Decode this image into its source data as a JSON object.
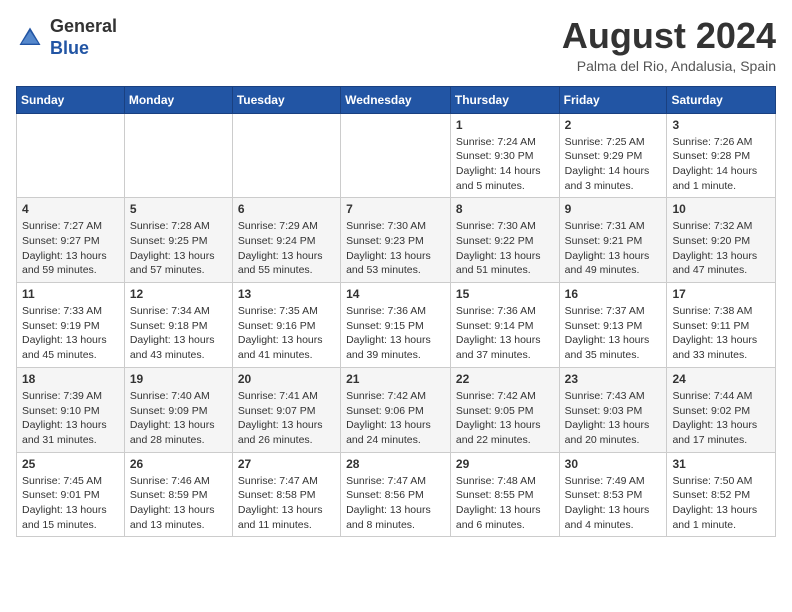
{
  "header": {
    "logo": {
      "general": "General",
      "blue": "Blue"
    },
    "month_year": "August 2024",
    "location": "Palma del Rio, Andalusia, Spain"
  },
  "days_of_week": [
    "Sunday",
    "Monday",
    "Tuesday",
    "Wednesday",
    "Thursday",
    "Friday",
    "Saturday"
  ],
  "weeks": [
    [
      {
        "day": "",
        "info": ""
      },
      {
        "day": "",
        "info": ""
      },
      {
        "day": "",
        "info": ""
      },
      {
        "day": "",
        "info": ""
      },
      {
        "day": "1",
        "info": "Sunrise: 7:24 AM\nSunset: 9:30 PM\nDaylight: 14 hours\nand 5 minutes."
      },
      {
        "day": "2",
        "info": "Sunrise: 7:25 AM\nSunset: 9:29 PM\nDaylight: 14 hours\nand 3 minutes."
      },
      {
        "day": "3",
        "info": "Sunrise: 7:26 AM\nSunset: 9:28 PM\nDaylight: 14 hours\nand 1 minute."
      }
    ],
    [
      {
        "day": "4",
        "info": "Sunrise: 7:27 AM\nSunset: 9:27 PM\nDaylight: 13 hours\nand 59 minutes."
      },
      {
        "day": "5",
        "info": "Sunrise: 7:28 AM\nSunset: 9:25 PM\nDaylight: 13 hours\nand 57 minutes."
      },
      {
        "day": "6",
        "info": "Sunrise: 7:29 AM\nSunset: 9:24 PM\nDaylight: 13 hours\nand 55 minutes."
      },
      {
        "day": "7",
        "info": "Sunrise: 7:30 AM\nSunset: 9:23 PM\nDaylight: 13 hours\nand 53 minutes."
      },
      {
        "day": "8",
        "info": "Sunrise: 7:30 AM\nSunset: 9:22 PM\nDaylight: 13 hours\nand 51 minutes."
      },
      {
        "day": "9",
        "info": "Sunrise: 7:31 AM\nSunset: 9:21 PM\nDaylight: 13 hours\nand 49 minutes."
      },
      {
        "day": "10",
        "info": "Sunrise: 7:32 AM\nSunset: 9:20 PM\nDaylight: 13 hours\nand 47 minutes."
      }
    ],
    [
      {
        "day": "11",
        "info": "Sunrise: 7:33 AM\nSunset: 9:19 PM\nDaylight: 13 hours\nand 45 minutes."
      },
      {
        "day": "12",
        "info": "Sunrise: 7:34 AM\nSunset: 9:18 PM\nDaylight: 13 hours\nand 43 minutes."
      },
      {
        "day": "13",
        "info": "Sunrise: 7:35 AM\nSunset: 9:16 PM\nDaylight: 13 hours\nand 41 minutes."
      },
      {
        "day": "14",
        "info": "Sunrise: 7:36 AM\nSunset: 9:15 PM\nDaylight: 13 hours\nand 39 minutes."
      },
      {
        "day": "15",
        "info": "Sunrise: 7:36 AM\nSunset: 9:14 PM\nDaylight: 13 hours\nand 37 minutes."
      },
      {
        "day": "16",
        "info": "Sunrise: 7:37 AM\nSunset: 9:13 PM\nDaylight: 13 hours\nand 35 minutes."
      },
      {
        "day": "17",
        "info": "Sunrise: 7:38 AM\nSunset: 9:11 PM\nDaylight: 13 hours\nand 33 minutes."
      }
    ],
    [
      {
        "day": "18",
        "info": "Sunrise: 7:39 AM\nSunset: 9:10 PM\nDaylight: 13 hours\nand 31 minutes."
      },
      {
        "day": "19",
        "info": "Sunrise: 7:40 AM\nSunset: 9:09 PM\nDaylight: 13 hours\nand 28 minutes."
      },
      {
        "day": "20",
        "info": "Sunrise: 7:41 AM\nSunset: 9:07 PM\nDaylight: 13 hours\nand 26 minutes."
      },
      {
        "day": "21",
        "info": "Sunrise: 7:42 AM\nSunset: 9:06 PM\nDaylight: 13 hours\nand 24 minutes."
      },
      {
        "day": "22",
        "info": "Sunrise: 7:42 AM\nSunset: 9:05 PM\nDaylight: 13 hours\nand 22 minutes."
      },
      {
        "day": "23",
        "info": "Sunrise: 7:43 AM\nSunset: 9:03 PM\nDaylight: 13 hours\nand 20 minutes."
      },
      {
        "day": "24",
        "info": "Sunrise: 7:44 AM\nSunset: 9:02 PM\nDaylight: 13 hours\nand 17 minutes."
      }
    ],
    [
      {
        "day": "25",
        "info": "Sunrise: 7:45 AM\nSunset: 9:01 PM\nDaylight: 13 hours\nand 15 minutes."
      },
      {
        "day": "26",
        "info": "Sunrise: 7:46 AM\nSunset: 8:59 PM\nDaylight: 13 hours\nand 13 minutes."
      },
      {
        "day": "27",
        "info": "Sunrise: 7:47 AM\nSunset: 8:58 PM\nDaylight: 13 hours\nand 11 minutes."
      },
      {
        "day": "28",
        "info": "Sunrise: 7:47 AM\nSunset: 8:56 PM\nDaylight: 13 hours\nand 8 minutes."
      },
      {
        "day": "29",
        "info": "Sunrise: 7:48 AM\nSunset: 8:55 PM\nDaylight: 13 hours\nand 6 minutes."
      },
      {
        "day": "30",
        "info": "Sunrise: 7:49 AM\nSunset: 8:53 PM\nDaylight: 13 hours\nand 4 minutes."
      },
      {
        "day": "31",
        "info": "Sunrise: 7:50 AM\nSunset: 8:52 PM\nDaylight: 13 hours\nand 1 minute."
      }
    ]
  ]
}
